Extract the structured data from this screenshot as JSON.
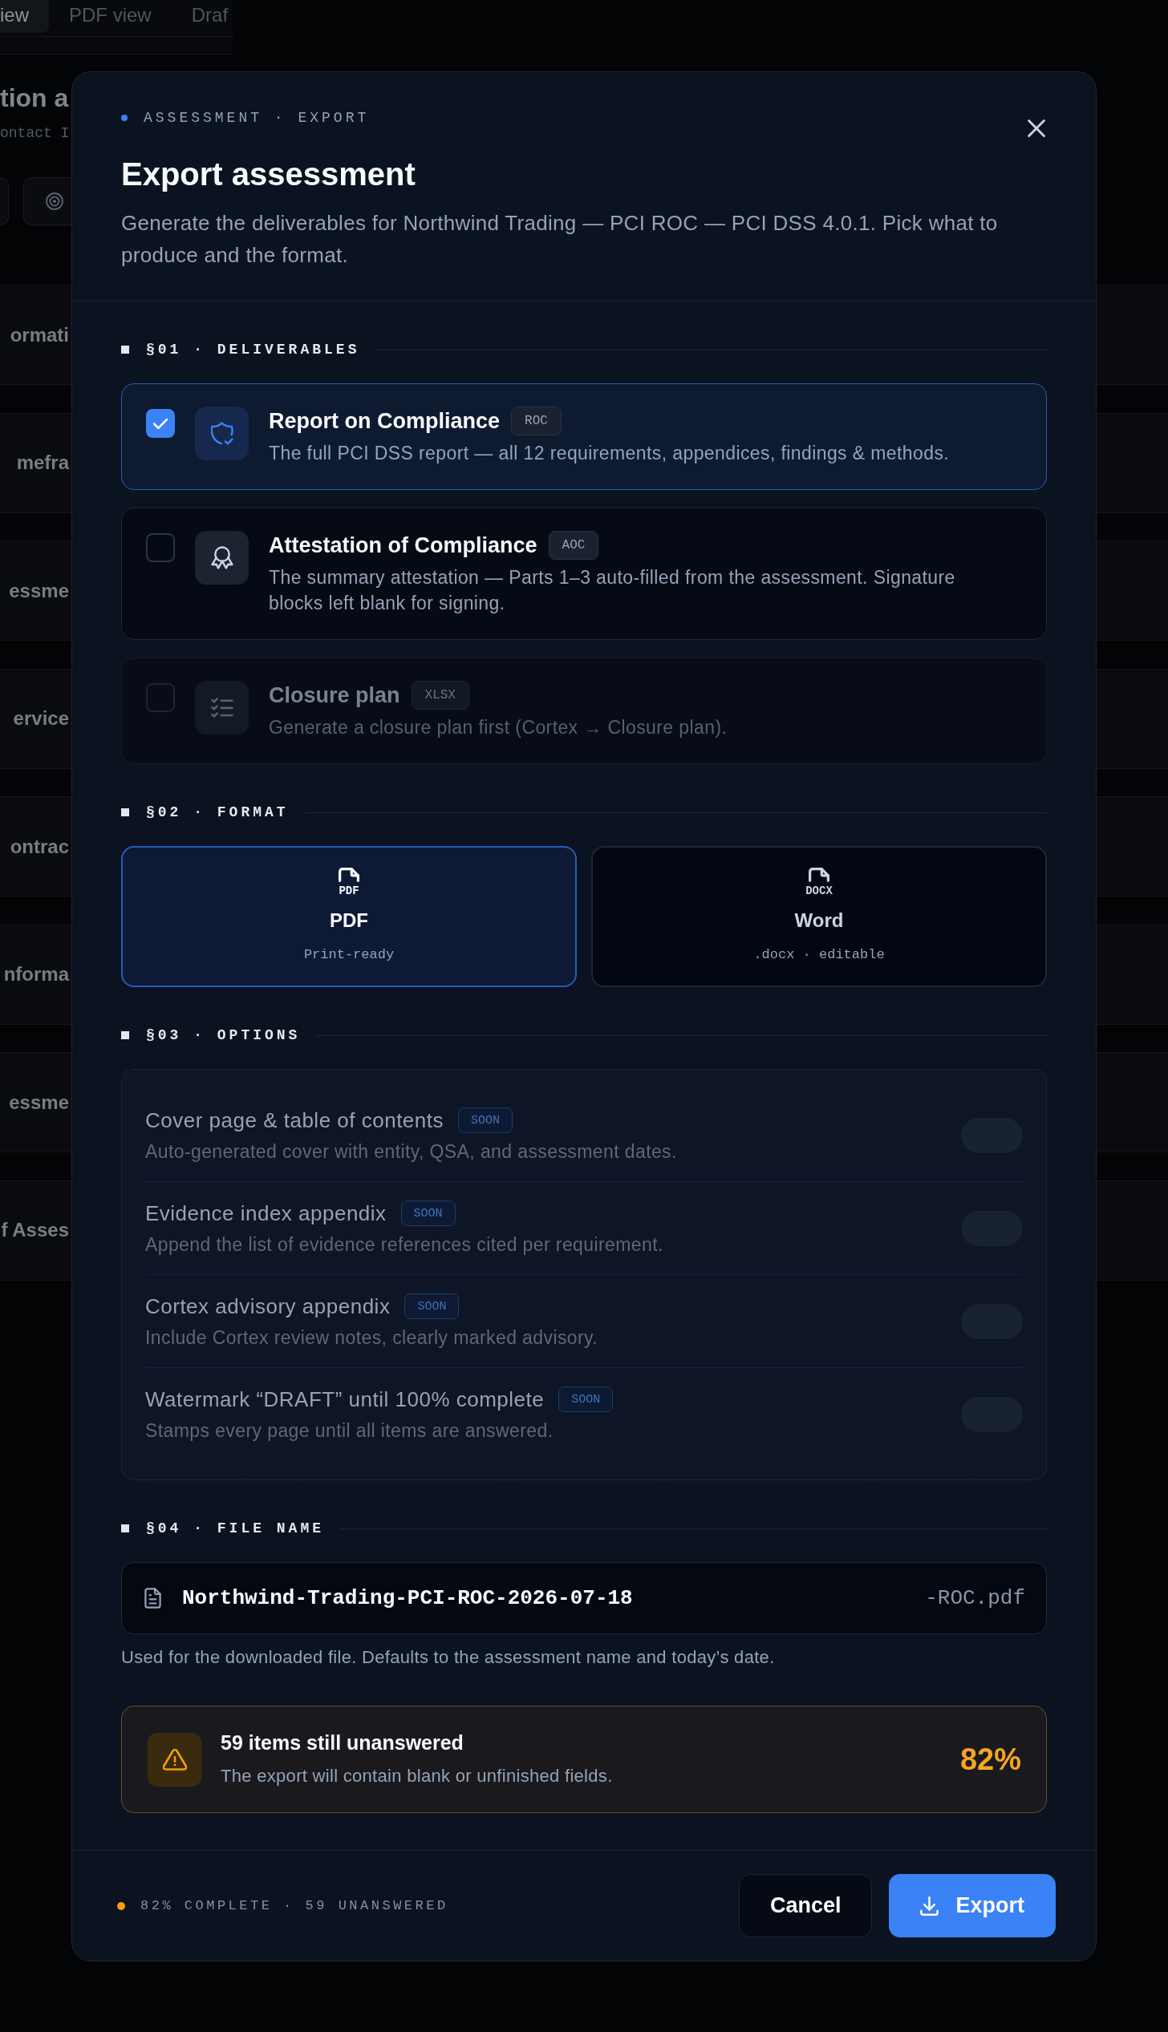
{
  "background": {
    "tabs": [
      {
        "label": "iew",
        "selected": true
      },
      {
        "label": "PDF view",
        "selected": false
      },
      {
        "label": "Draf",
        "selected": false
      }
    ],
    "heading": "tion a",
    "subheading": "ontact I",
    "rows": [
      "ormati",
      "mefra",
      "essme",
      "ervice",
      "ontrac",
      "nforma",
      "essme",
      "f Asses"
    ]
  },
  "dialog": {
    "eyebrow": "ASSESSMENT · EXPORT",
    "title": "Export assessment",
    "description": "Generate the deliverables for Northwind Trading — PCI ROC — PCI DSS 4.0.1. Pick what to produce and the format.",
    "deliverables": {
      "heading": "§01 · DELIVERABLES",
      "items": [
        {
          "title": "Report on Compliance",
          "tag": "ROC",
          "description": "The full PCI DSS report — all 12 requirements, appendices, findings & methods.",
          "checked": true,
          "disabled": false
        },
        {
          "title": "Attestation of Compliance",
          "tag": "AOC",
          "description": "The summary attestation — Parts 1–3 auto-filled from the assessment. Signature blocks left blank for signing.",
          "checked": false,
          "disabled": false
        },
        {
          "title": "Closure plan",
          "tag": "XLSX",
          "description": "Generate a closure plan first (Cortex → Closure plan).",
          "checked": false,
          "disabled": true
        }
      ]
    },
    "format": {
      "heading": "§02 · FORMAT",
      "options": [
        {
          "file_type": "PDF",
          "label": "PDF",
          "caption": "Print-ready",
          "selected": true
        },
        {
          "file_type": "DOCX",
          "label": "Word",
          "caption": ".docx · editable",
          "selected": false
        }
      ]
    },
    "options": {
      "heading": "§03 · OPTIONS",
      "items": [
        {
          "title": "Cover page & table of contents",
          "tag": "SOON",
          "description": "Auto-generated cover with entity, QSA, and assessment dates.",
          "on": false,
          "disabled": true
        },
        {
          "title": "Evidence index appendix",
          "tag": "SOON",
          "description": "Append the list of evidence references cited per requirement.",
          "on": false,
          "disabled": true
        },
        {
          "title": "Cortex advisory appendix",
          "tag": "SOON",
          "description": "Include Cortex review notes, clearly marked advisory.",
          "on": false,
          "disabled": true
        },
        {
          "title": "Watermark “DRAFT” until 100% complete",
          "tag": "SOON",
          "description": "Stamps every page until all items are answered.",
          "on": false,
          "disabled": true
        }
      ]
    },
    "file_name": {
      "heading": "§04 · FILE NAME",
      "value": "Northwind-Trading-PCI-ROC-2026-07-18",
      "suffix": "-ROC.pdf",
      "hint": "Used for the downloaded file. Defaults to the assessment name and today’s date."
    },
    "warning": {
      "title": "59 items still unanswered",
      "description": "The export will contain blank or unfinished fields.",
      "percent": "82%"
    },
    "footer": {
      "status": "82% COMPLETE · 59 UNANSWERED",
      "buttons": [
        {
          "label": "Cancel",
          "kind": "secondary"
        },
        {
          "label": "Export",
          "kind": "primary"
        }
      ]
    }
  }
}
